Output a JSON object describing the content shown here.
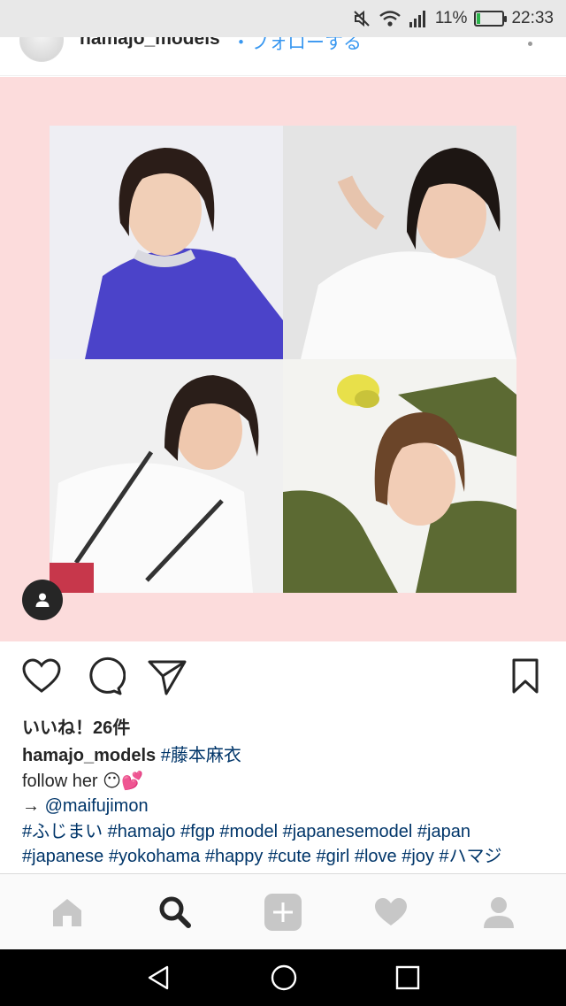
{
  "status_bar": {
    "battery_percent": "11%",
    "time": "22:33",
    "battery_level": 0.11,
    "battery_color": "#2bb34a"
  },
  "post_header": {
    "username": "hamajo_models",
    "follow_label": "・フォローする"
  },
  "image": {
    "background_color": "#fcdcdc",
    "photos": [
      "photo-top-left",
      "photo-top-right",
      "photo-bottom-left",
      "photo-bottom-right"
    ]
  },
  "actions": {
    "icons": [
      "heart-icon",
      "comment-icon",
      "share-icon",
      "bookmark-icon"
    ]
  },
  "likes": "いいね！26件",
  "caption": {
    "username": "hamajo_models",
    "first_tag": "#藤本麻衣",
    "line2_text": "follow her ",
    "line2_emoji": "😶💕",
    "line3_arrow": "→ ",
    "line3_mention": "@maifujimon",
    "line4": "#ふじまい #hamajo #fgp #model #japanesemodel #japan",
    "line5": "#japanese #yokohama #happy #cute #girl #love #joy #ハマジ",
    "link_color": "#003569"
  },
  "bottom_nav": {
    "items": [
      "home-icon",
      "search-icon",
      "add-icon",
      "activity-heart-icon",
      "profile-icon"
    ],
    "active": "search-icon"
  }
}
